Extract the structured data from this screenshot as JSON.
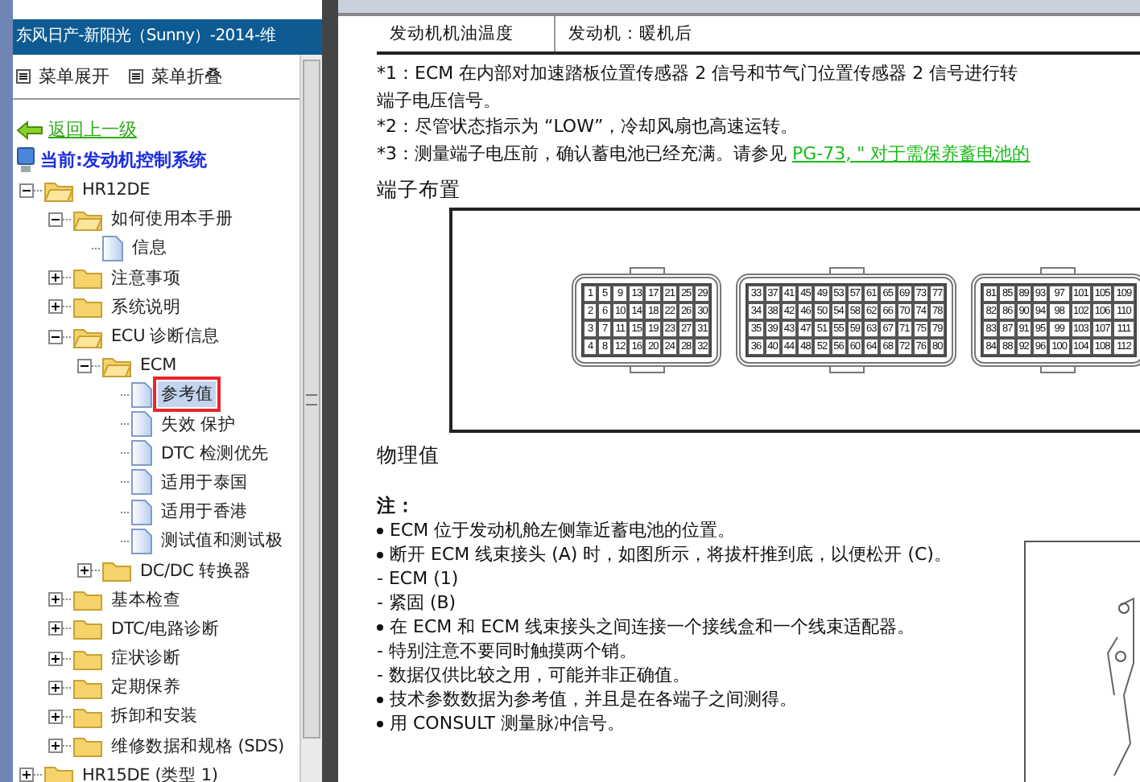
{
  "sidebar": {
    "title": "东风日产-新阳光（Sunny）-2014-维",
    "menu_buttons": [
      "菜单展开",
      "菜单折叠"
    ],
    "back_link": "返回上一级",
    "current": "当前:发动机控制系统",
    "tree": [
      {
        "label": "HR12DE",
        "kind": "folder",
        "expanded": true,
        "selected": false,
        "children": [
          {
            "label": "如何使用本手册",
            "kind": "folder",
            "expanded": true,
            "selected": false,
            "children": [
              {
                "label": "信息",
                "kind": "page",
                "selected": false
              }
            ]
          },
          {
            "label": "注意事项",
            "kind": "folder",
            "expanded": false,
            "selected": false
          },
          {
            "label": "系统说明",
            "kind": "folder",
            "expanded": false,
            "selected": false
          },
          {
            "label": "ECU 诊断信息",
            "kind": "folder",
            "expanded": true,
            "selected": false,
            "children": [
              {
                "label": "ECM",
                "kind": "folder",
                "expanded": true,
                "selected": false,
                "children": [
                  {
                    "label": "参考值",
                    "kind": "page",
                    "selected": true
                  },
                  {
                    "label": "失效 保护",
                    "kind": "page",
                    "selected": false
                  },
                  {
                    "label": "DTC 检测优先",
                    "kind": "page",
                    "selected": false
                  },
                  {
                    "label": "适用于泰国",
                    "kind": "page",
                    "selected": false
                  },
                  {
                    "label": "适用于香港",
                    "kind": "page",
                    "selected": false
                  },
                  {
                    "label": "测试值和测试极",
                    "kind": "page",
                    "selected": false
                  }
                ]
              },
              {
                "label": "DC/DC 转换器",
                "kind": "folder",
                "expanded": false,
                "selected": false
              }
            ]
          },
          {
            "label": "基本检查",
            "kind": "folder",
            "expanded": false,
            "selected": false
          },
          {
            "label": "DTC/电路诊断",
            "kind": "folder",
            "expanded": false,
            "selected": false
          },
          {
            "label": "症状诊断",
            "kind": "folder",
            "expanded": false,
            "selected": false
          },
          {
            "label": "定期保养",
            "kind": "folder",
            "expanded": false,
            "selected": false
          },
          {
            "label": "拆卸和安装",
            "kind": "folder",
            "expanded": false,
            "selected": false
          },
          {
            "label": "维修数据和规格 (SDS)",
            "kind": "folder",
            "expanded": false,
            "selected": false
          }
        ]
      },
      {
        "label": "HR15DE (类型 1)",
        "kind": "folder",
        "expanded": false,
        "selected": false
      }
    ]
  },
  "content": {
    "table_row": [
      "发动机机油温度",
      "发动机：暖机后"
    ],
    "notes": [
      {
        "text": "*1：ECM 在内部对加速踏板位置传感器 2 信号和节气门位置传感器 2 信号进行转"
      },
      {
        "text": "端子电压信号。"
      },
      {
        "text": "*2：尽管状态指示为 “LOW”，冷却风扇也高速运转。"
      },
      {
        "text": "*3：测量端子电压前，确认蓄电池已经充满。请参见 ",
        "link": "PG-73, \" 对于需保养蓄电池的"
      }
    ],
    "terminal_heading": "端子布置",
    "connectors": [
      {
        "pins": [
          "1",
          "2",
          "3",
          "4",
          "5",
          "6",
          "7",
          "8",
          "9",
          "10",
          "11",
          "12",
          "13",
          "14",
          "15",
          "16",
          "17",
          "18",
          "19",
          "20",
          "21",
          "22",
          "23",
          "24",
          "25",
          "26",
          "27",
          "28",
          "29",
          "30",
          "31",
          "32"
        ]
      },
      {
        "pins": [
          "33",
          "34",
          "35",
          "36",
          "37",
          "38",
          "39",
          "40",
          "41",
          "42",
          "43",
          "44",
          "45",
          "46",
          "47",
          "48",
          "49",
          "50",
          "51",
          "52",
          "53",
          "54",
          "55",
          "56",
          "57",
          "58",
          "59",
          "60",
          "61",
          "62",
          "63",
          "64",
          "65",
          "66",
          "67",
          "68",
          "69",
          "70",
          "71",
          "72",
          "73",
          "74",
          "75",
          "76",
          "77",
          "78",
          "79",
          "80"
        ]
      },
      {
        "pins": [
          "81",
          "82",
          "83",
          "84",
          "85",
          "86",
          "87",
          "88",
          "89",
          "90",
          "91",
          "92",
          "93",
          "94",
          "95",
          "96",
          "97",
          "98",
          "99",
          "100",
          "101",
          "102",
          "103",
          "104",
          "105",
          "106",
          "107",
          "108",
          "109",
          "110",
          "111",
          "112"
        ]
      }
    ],
    "physical_heading": "物理值",
    "note_heading": "注：",
    "list": [
      {
        "kind": "bullet",
        "text": "ECM 位于发动机舱左侧靠近蓄电池的位置。"
      },
      {
        "kind": "bullet",
        "text": "断开 ECM 线束接头 (A) 时，如图所示，将拔杆推到底，以便松开 (C)。"
      },
      {
        "kind": "dash",
        "text": "- ECM (1)"
      },
      {
        "kind": "dash",
        "text": "- 紧固 (B)"
      },
      {
        "kind": "bullet",
        "text": "在 ECM 和 ECM 线束接头之间连接一个接线盒和一个线束适配器。"
      },
      {
        "kind": "dash",
        "text": "- 特别注意不要同时触摸两个销。"
      },
      {
        "kind": "dash",
        "text": "- 数据仅供比较之用，可能并非正确值。"
      },
      {
        "kind": "bullet",
        "text": "技术参数数据为参考值，并且是在各端子之间测得。"
      },
      {
        "kind": "bullet",
        "text": "用 CONSULT 测量脉冲信号。"
      }
    ]
  }
}
